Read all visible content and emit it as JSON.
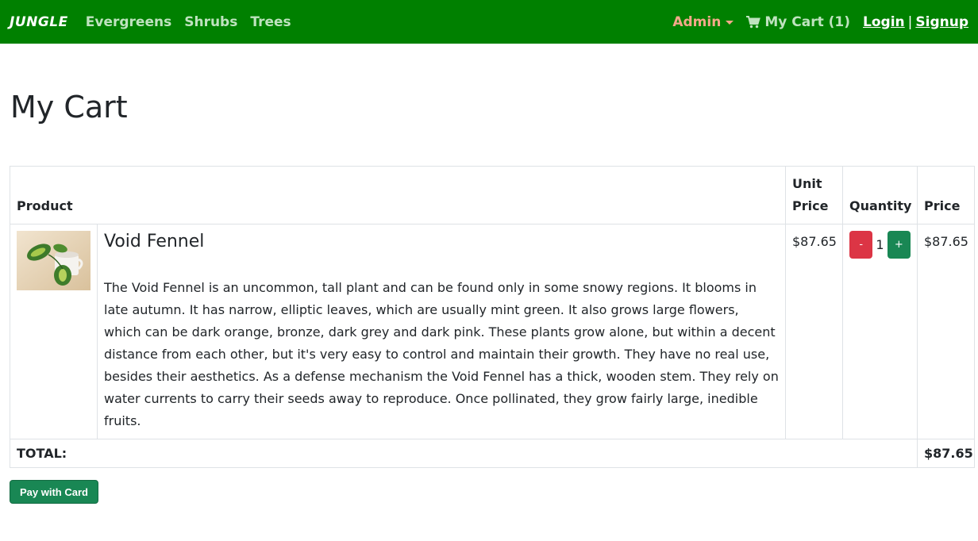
{
  "nav": {
    "brand": "JUNGLE",
    "links": [
      "Evergreens",
      "Shrubs",
      "Trees"
    ],
    "admin": "Admin",
    "cart": "My Cart (1)",
    "login": "Login",
    "separator": "|",
    "signup": "Signup"
  },
  "page_title": "My Cart",
  "table": {
    "headers": {
      "product": "Product",
      "unit_price": "Unit Price",
      "quantity": "Quantity",
      "price": "Price"
    },
    "items": [
      {
        "name": "Void Fennel",
        "description": "The Void Fennel is an uncommon, tall plant and can be found only in some snowy regions. It blooms in late autumn. It has narrow, elliptic leaves, which are usually mint green. It also grows large flowers, which can be dark orange, bronze, dark grey and dark pink. These plants grow alone, but within a decent distance from each other, but it's very easy to control and maintain their growth. They have no real use, besides their aesthetics. As a defense mechanism the Void Fennel has a thick, wooden stem. They rely on water currents to carry their seeds away to reproduce. Once pollinated, they grow fairly large, inedible fruits.",
        "unit_price": "$87.65",
        "quantity": "1",
        "minus": "-",
        "plus": "+",
        "price": "$87.65"
      }
    ],
    "total_label": "TOTAL:",
    "total_value": "$87.65"
  },
  "pay_button": "Pay with Card",
  "colors": {
    "navbar": "#008000",
    "admin": "#f5a98a",
    "minus_button": "#dc3545",
    "plus_button": "#198754"
  }
}
